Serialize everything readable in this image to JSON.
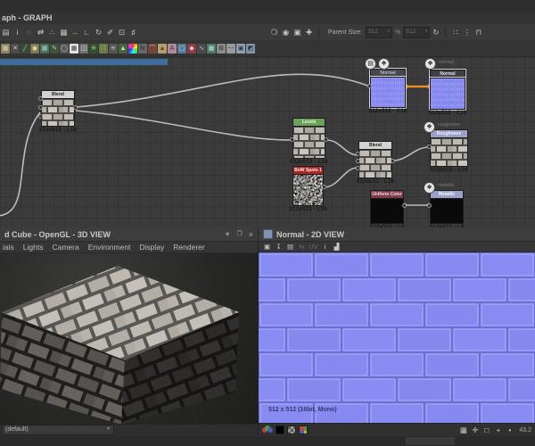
{
  "graph": {
    "tab_title": "aph - GRAPH",
    "toolbar": {
      "group1": [
        {
          "name": "graph-view-icon",
          "glyph": "▤"
        },
        {
          "name": "info-icon",
          "glyph": "i"
        },
        {
          "name": "zoom-icon",
          "glyph": "◌"
        },
        {
          "name": "fit-view-icon",
          "glyph": "⇄"
        },
        {
          "name": "expose-parameters-icon",
          "glyph": "∴"
        },
        {
          "name": "grid-table-icon",
          "glyph": "▦"
        },
        {
          "name": "straight-links-icon",
          "glyph": "↔",
          "color": "#3a3a3a",
          "fg": "#d28b26"
        },
        {
          "name": "elbow-links-icon",
          "glyph": "∟"
        },
        {
          "name": "timer-icon",
          "glyph": "↻"
        },
        {
          "name": "tools-icon",
          "glyph": "✐"
        },
        {
          "name": "export-icon",
          "glyph": "⊡"
        },
        {
          "name": "snap-grid-icon",
          "glyph": "♯"
        }
      ],
      "group2": [
        {
          "name": "comment-icon",
          "glyph": "❍"
        },
        {
          "name": "pin-node-icon",
          "glyph": "◉"
        },
        {
          "name": "frame-icon",
          "glyph": "▣"
        },
        {
          "name": "todo-icon",
          "glyph": "✚"
        }
      ],
      "parent_size_label": "Parent Size:",
      "parent_width": "512",
      "parent_height": "512",
      "link_wh_glyph": "%",
      "reset_glyph": "↻",
      "group3": [
        {
          "name": "dual-dot-icon",
          "glyph": "∷"
        },
        {
          "name": "stack-icon",
          "glyph": "⋮"
        },
        {
          "name": "auto-layout-icon",
          "glyph": "⊓"
        }
      ]
    },
    "palette": [
      {
        "name": "bitmap-node-icon",
        "color": "#8f845f",
        "glyph": "▦",
        "fg": "#d8d2bc"
      },
      {
        "name": "svg-node-icon",
        "color": "#4c4c4c",
        "glyph": "✕",
        "fg": "#cfcfcf"
      },
      {
        "name": "curve-node-icon",
        "color": "#3c4a3c",
        "glyph": "╱",
        "fg": "#8fd47a"
      },
      {
        "name": "blob-node-icon",
        "color": "#7d7a52",
        "glyph": "◉",
        "fg": "#ece7c8"
      },
      {
        "name": "gradient-map-icon",
        "color": "#49705f",
        "glyph": "▦",
        "fg": "#9fd8c2"
      },
      {
        "name": "pencil-node-icon",
        "color": "#3f5140",
        "glyph": "✎",
        "fg": "#9fe08a"
      },
      {
        "name": "shape-node-icon",
        "color": "#585858",
        "glyph": "◯",
        "fg": "#d0d0d0"
      },
      {
        "name": "tile-generator-icon",
        "color": "#e3e3e3",
        "glyph": "▦",
        "fg": "#3a3a3a"
      },
      {
        "name": "cube3d-node-icon",
        "color": "#6f6f6f",
        "glyph": "◫",
        "fg": "#e0e0e0"
      },
      {
        "name": "fractal-node-icon",
        "color": "#33502e",
        "glyph": "❋",
        "fg": "#7fba6a"
      },
      {
        "name": "spots-node-icon",
        "color": "#6b7a48",
        "glyph": "∷",
        "fg": "#d8e8b0"
      },
      {
        "name": "perlin-noise-icon",
        "color": "#565656",
        "glyph": "≋",
        "fg": "#bdbdbd"
      },
      {
        "name": "pyramid-node-icon",
        "color": "#47663f",
        "glyph": "▲",
        "fg": "#cfe8c0"
      },
      {
        "name": "color-wheel-icon",
        "color": "conic",
        "glyph": "",
        "fg": "#ffffff"
      },
      {
        "name": "fx-map-icon",
        "color": "#686868",
        "glyph": "fx",
        "fg": "#2b2b2b"
      },
      {
        "name": "arch-node-icon",
        "color": "#77463a",
        "glyph": "⌒",
        "fg": "#e0b9a8"
      },
      {
        "name": "warning-triangle-icon",
        "color": "#b3a06b",
        "glyph": "▲",
        "fg": "#4a4330"
      },
      {
        "name": "text-node-icon",
        "color": "#b08a99",
        "glyph": "A",
        "fg": "#4a2a38"
      },
      {
        "name": "selection-box-icon",
        "color": "#567a99",
        "glyph": "▢",
        "fg": "#cfe4f4"
      },
      {
        "name": "paint-bucket-icon",
        "color": "#8a4040",
        "glyph": "◆",
        "fg": "#e8c8c8"
      },
      {
        "name": "wave-node-icon",
        "color": "#4a4a4a",
        "glyph": "∿",
        "fg": "#bdbdbd"
      },
      {
        "name": "grid-teal-icon",
        "color": "#4d7a70",
        "glyph": "▦",
        "fg": "#bfe4da"
      },
      {
        "name": "plus-box-icon",
        "color": "#8c8c8c",
        "glyph": "⊞",
        "fg": "#2e2e2e"
      },
      {
        "name": "dots-node-icon",
        "color": "#9a9a9a",
        "glyph": "⋯",
        "fg": "#2e2e2e"
      },
      {
        "name": "light-box-icon",
        "color": "#93a0ac",
        "glyph": "▣",
        "fg": "#2f3a44"
      },
      {
        "name": "blue-box-icon",
        "color": "#7e94a6",
        "glyph": "◩",
        "fg": "#23313d"
      }
    ],
    "nodes": [
      {
        "id": "blend-left",
        "label": "Blend",
        "caption": "512x512 - L16",
        "header_bg": "#d2d2d2"
      },
      {
        "id": "levels",
        "label": "Levels",
        "caption": "512x512 - L16",
        "header_bg": "#69a258"
      },
      {
        "id": "bnw-spots-1",
        "label": "BnW Spots 1",
        "caption": "512x512 - L16",
        "header_bg": "#a82828"
      },
      {
        "id": "blend-2",
        "label": "Blend",
        "caption": "512x512 - L16",
        "header_bg": "#d2d2d2"
      },
      {
        "id": "normal-filter",
        "label": "Normal",
        "caption": "512x512 - C16",
        "header_bg": "#46464e"
      },
      {
        "id": "normal-output",
        "label": "Normal",
        "caption": "512x512 - C16",
        "header_bg": "#3f3f47",
        "badge_label": "normal"
      },
      {
        "id": "roughness-output",
        "label": "Roughness",
        "caption": "512x512 - L16",
        "header_bg": "#9aa0c6",
        "badge_label": "roughness"
      },
      {
        "id": "uniform-color",
        "label": "Uniform Color",
        "caption": "512x512 - L8",
        "header_bg": "#7d3b4c"
      },
      {
        "id": "metallic-output",
        "label": "Metallic",
        "caption": "512x512 - L8",
        "header_bg": "#9aa0c6",
        "badge_label": "metallic"
      }
    ],
    "connections": [
      {
        "from": "Blend",
        "to": "Normal"
      },
      {
        "from": "Blend",
        "to": "Levels"
      },
      {
        "from": "Levels",
        "to": "Blend (2)"
      },
      {
        "from": "BnW Spots 1",
        "to": "Blend (2)"
      },
      {
        "from": "Blend (2)",
        "to": "Roughness"
      },
      {
        "from": "Uniform Color",
        "to": "Metallic"
      },
      {
        "from": "Normal",
        "to": "Normal output",
        "selected": true
      }
    ],
    "accent_orange": "#ef9022",
    "frame_blue": "#3e6d99"
  },
  "view3d": {
    "title": "d Cube - OpenGL - 3D VIEW",
    "window_tools": [
      {
        "name": "pin-icon",
        "glyph": "➤"
      },
      {
        "name": "float-window-icon",
        "glyph": "❐"
      },
      {
        "name": "close-icon",
        "glyph": "×"
      }
    ],
    "menus": [
      {
        "name": "menu-materials",
        "label": "ials"
      },
      {
        "name": "menu-lights",
        "label": "Lights"
      },
      {
        "name": "menu-camera",
        "label": "Camera"
      },
      {
        "name": "menu-environment",
        "label": "Environment"
      },
      {
        "name": "menu-display",
        "label": "Display"
      },
      {
        "name": "menu-renderer",
        "label": "Renderer"
      }
    ],
    "material_dropdown": "(default)"
  },
  "view2d": {
    "title": "Normal - 2D VIEW",
    "toolbar": [
      {
        "name": "copy-image-icon",
        "glyph": "▣"
      },
      {
        "name": "save-image-icon",
        "glyph": "↧"
      },
      {
        "name": "paste-image-icon",
        "glyph": "▤"
      },
      {
        "name": "link-view-icon",
        "glyph": "⇆",
        "dim": true
      },
      {
        "name": "uv-dropdown",
        "glyph": "UV ▾",
        "dim": true
      },
      {
        "name": "info-icon",
        "glyph": "i"
      },
      {
        "name": "histogram-icon",
        "glyph": "▟"
      }
    ],
    "status_text": "512 x 512 (16bit, Mono)",
    "bottom_right_icons": [
      {
        "name": "grid-overlay-icon",
        "glyph": "▦"
      },
      {
        "name": "transform-icon",
        "glyph": "✛"
      },
      {
        "name": "frame-select-icon",
        "glyph": "□"
      },
      {
        "name": "pan-icon",
        "glyph": "+"
      },
      {
        "name": "dot-icon",
        "glyph": "•"
      }
    ],
    "zoom_value": "43.2"
  }
}
